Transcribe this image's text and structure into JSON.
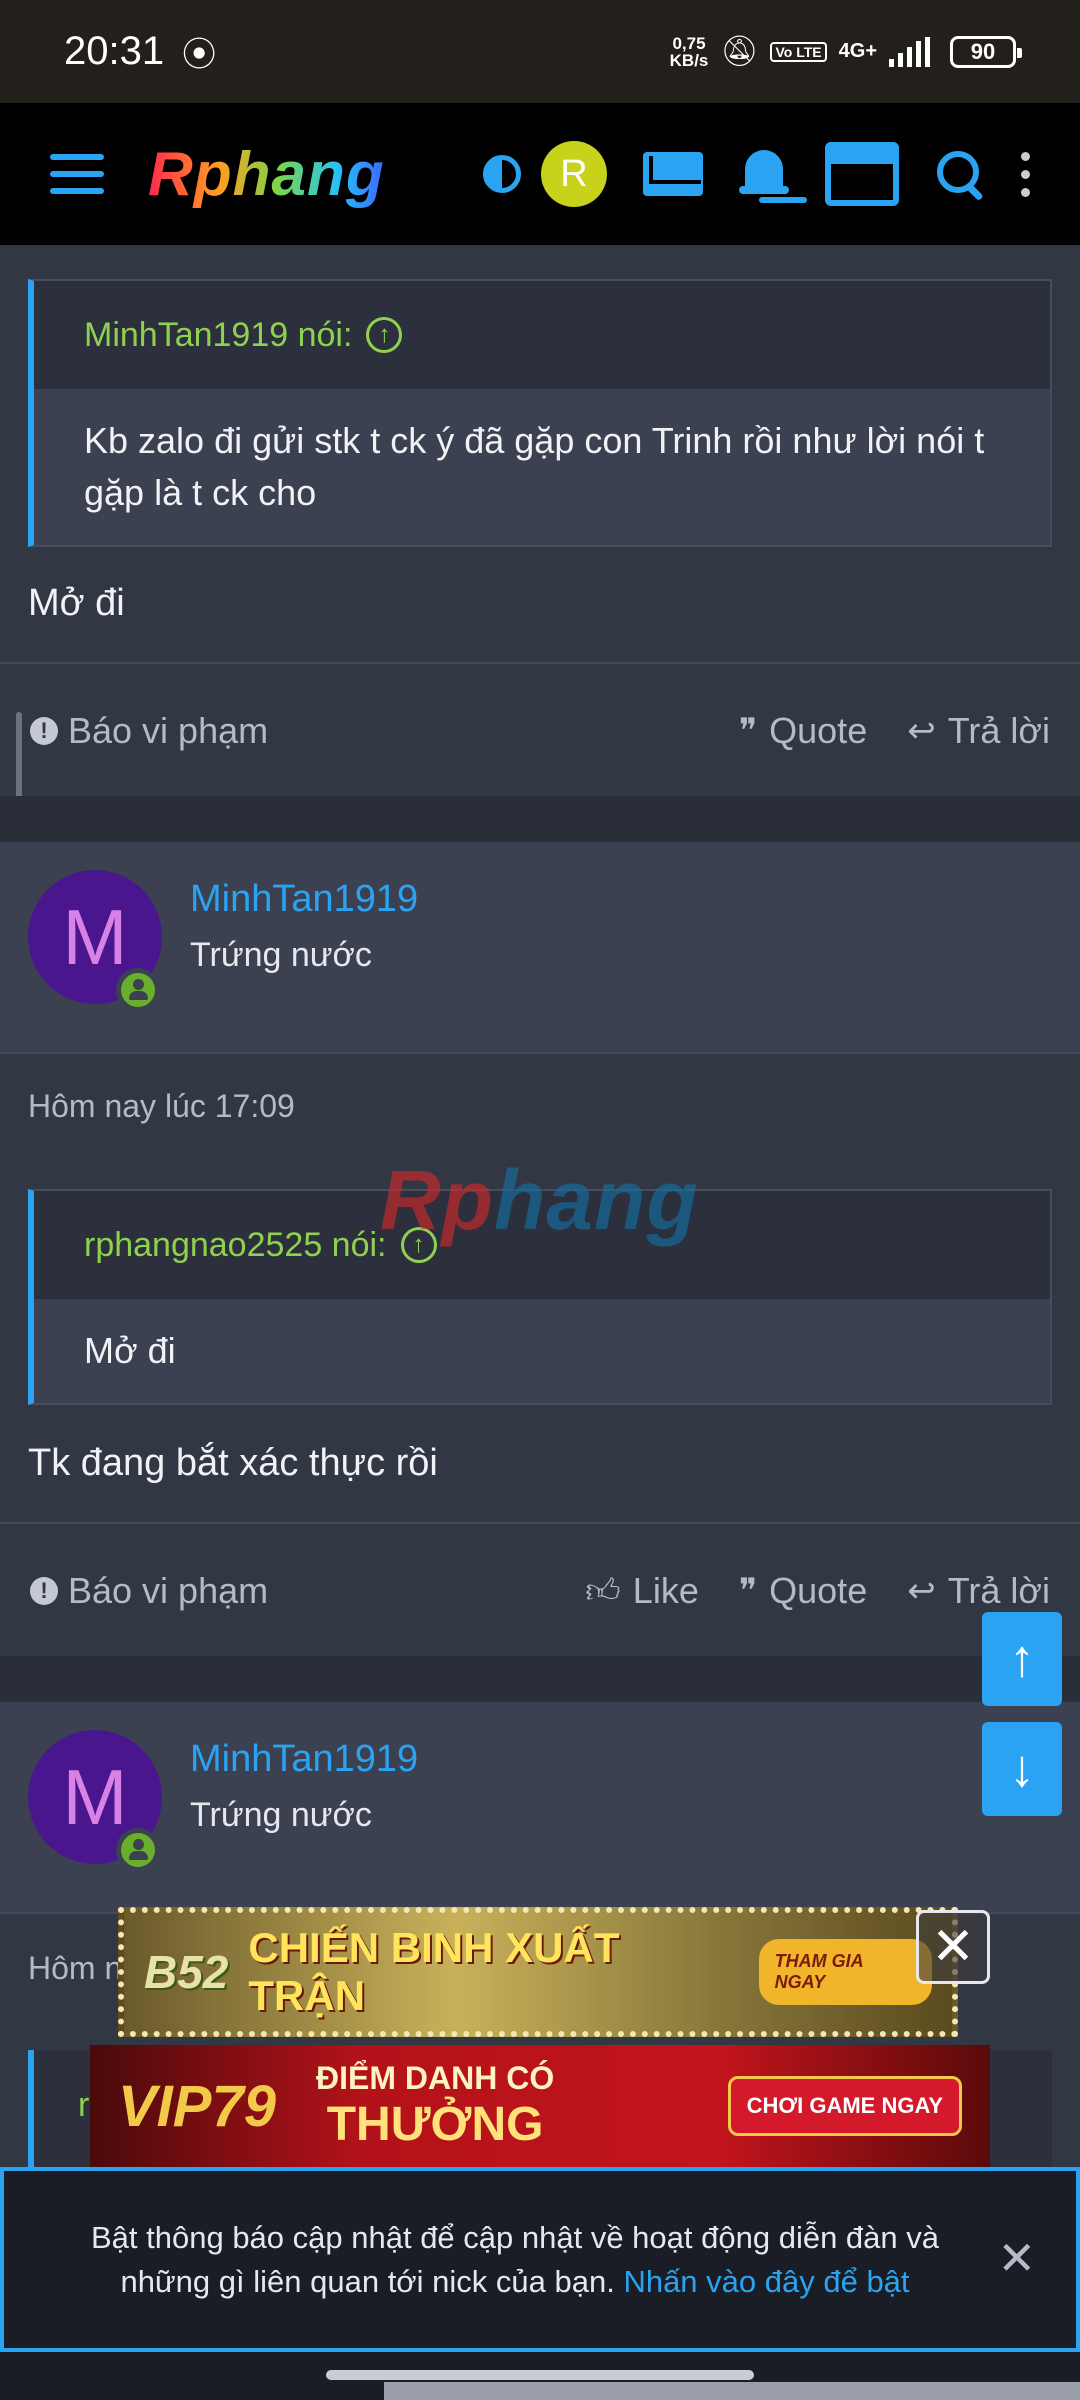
{
  "status_bar": {
    "time": "20:31",
    "net_speed_value": "0,75",
    "net_speed_unit": "KB/s",
    "volte": "Vo LTE",
    "network": "4G+",
    "battery": "90"
  },
  "header": {
    "logo": "Rphang",
    "avatar_letter": "R",
    "colors": {
      "accent": "#2aa3f2",
      "avatar": "#c9d21a",
      "background": "#000000"
    }
  },
  "post1": {
    "quote_author": "MinhTan1919 nói:",
    "quote_text": "Kb zalo đi gửi stk t ck ý đã gặp con Trinh rồi như lời nói t gặp là t ck cho",
    "message": "Mở đi",
    "report_label": "Báo vi phạm",
    "quote_label": "Quote",
    "reply_label": "Trả lời"
  },
  "post2": {
    "avatar_letter": "M",
    "username": "MinhTan1919",
    "user_title": "Trứng nước",
    "timestamp": "Hôm nay lúc 17:09",
    "quote_author": "rphangnao2525 nói:",
    "quote_text": "Mở đi",
    "message": "Tk đang bắt xác thực rồi",
    "report_label": "Báo vi phạm",
    "like_label": "Like",
    "quote_label": "Quote",
    "reply_label": "Trả lời"
  },
  "post3": {
    "avatar_letter": "M",
    "username": "MinhTan1919",
    "user_title": "Trứng nước",
    "timestamp_partial": "Hôm n",
    "quote_partial": "r"
  },
  "watermark": {
    "part1": "Rp",
    "part2": "hang"
  },
  "ads": {
    "ad1_brand": "B52",
    "ad1_text": "CHIẾN BINH XUẤT TRẬN",
    "ad1_button": "THAM GIA NGAY",
    "ad2_brand": "VIP79",
    "ad2_line1": "ĐIỂM DANH CÓ",
    "ad2_line2": "THƯỞNG",
    "ad2_button": "CHƠI GAME NGAY"
  },
  "notification": {
    "text": "Bật thông báo cập nhật để cập nhật về hoạt động diễn đàn và những gì liên quan tới nick của bạn.",
    "link": "Nhấn vào đây để bật"
  }
}
